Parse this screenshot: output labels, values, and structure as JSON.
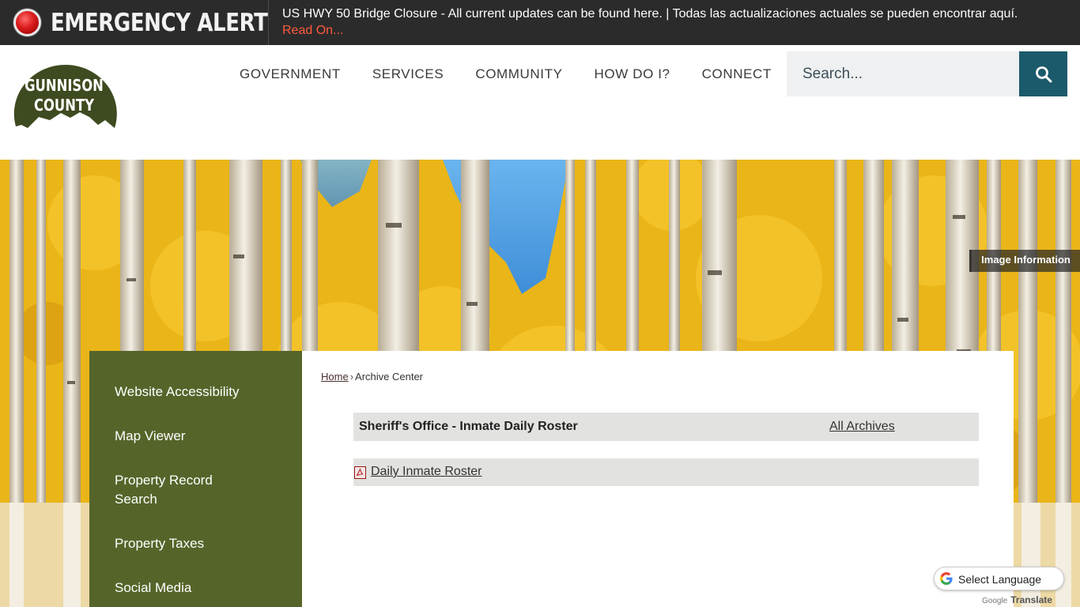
{
  "alert": {
    "title": "EMERGENCY ALERT",
    "message": "US HWY 50 Bridge Closure - All current updates can be found here. | Todas las actualizaciones actuales se pueden encontrar aquí.",
    "read_more": "Read On..."
  },
  "logo": {
    "line1": "GUNNISON",
    "line2": "COUNTY"
  },
  "nav": [
    "GOVERNMENT",
    "SERVICES",
    "COMMUNITY",
    "HOW DO I?",
    "CONNECT"
  ],
  "search": {
    "placeholder": "Search...",
    "icon": "search-icon"
  },
  "banner": {
    "image_info": "Image Information"
  },
  "sidebar": {
    "items": [
      {
        "label": "Website Accessibility"
      },
      {
        "label": "Map Viewer"
      },
      {
        "label": "Property Record Search"
      },
      {
        "label": "Property Taxes"
      },
      {
        "label": "Social Media"
      }
    ]
  },
  "breadcrumb": {
    "home": "Home",
    "separator": "›",
    "current": "Archive Center"
  },
  "archive": {
    "title": "Sheriff's Office - Inmate Daily Roster",
    "all_archives": "All Archives",
    "items": [
      {
        "label": "Daily Inmate Roster",
        "icon": "pdf-icon"
      }
    ]
  },
  "translate": {
    "label": "Select Language",
    "powered_by": "Google",
    "translate": "Translate"
  },
  "colors": {
    "alert_bg": "#2b2b2b",
    "logo_green": "#3e4a1f",
    "sidebar_green": "#55652a",
    "search_btn": "#1b5a6b",
    "alert_link": "#ff5a3c"
  }
}
